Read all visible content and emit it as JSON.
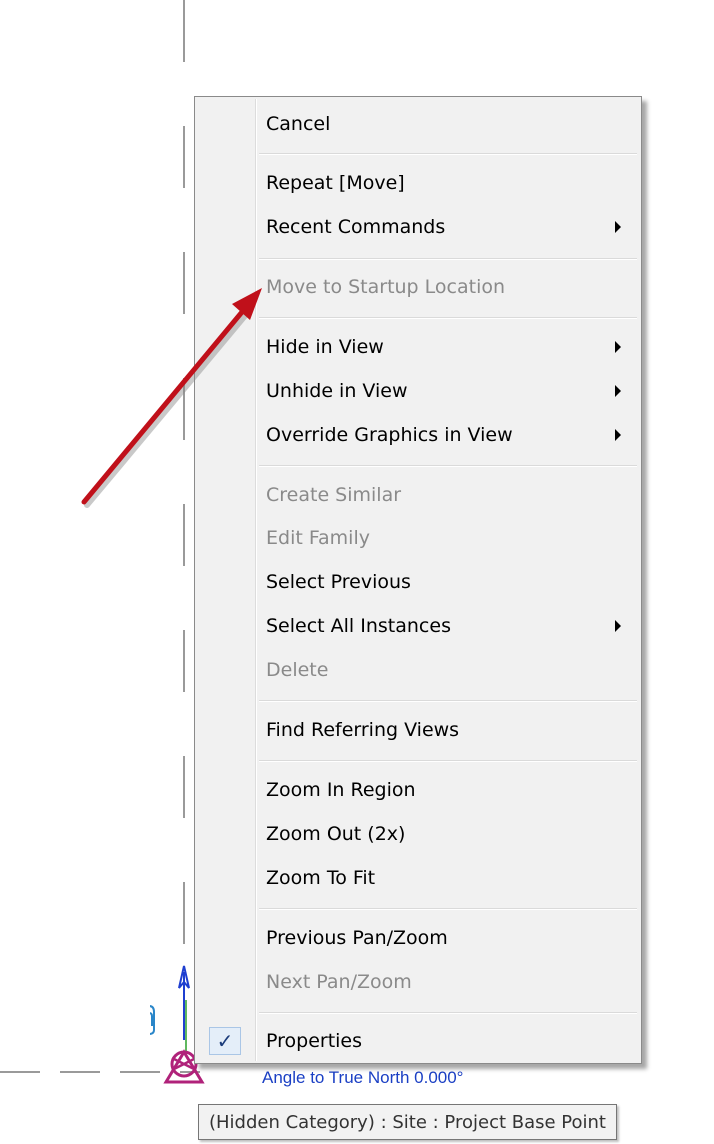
{
  "context_menu": {
    "items": [
      {
        "label": "Cancel",
        "disabled": false
      },
      {
        "label": "Repeat [Move]",
        "disabled": false
      },
      {
        "label": "Recent Commands",
        "disabled": false,
        "submenu": true
      },
      {
        "label": "Move to Startup Location",
        "disabled": true
      },
      {
        "label": "Hide in View",
        "disabled": false,
        "submenu": true
      },
      {
        "label": "Unhide in View",
        "disabled": false,
        "submenu": true
      },
      {
        "label": "Override Graphics in View",
        "disabled": false,
        "submenu": true
      },
      {
        "label": "Create Similar",
        "disabled": true
      },
      {
        "label": "Edit Family",
        "disabled": true
      },
      {
        "label": "Select Previous",
        "disabled": false
      },
      {
        "label": "Select All Instances",
        "disabled": false,
        "submenu": true
      },
      {
        "label": "Delete",
        "disabled": true
      },
      {
        "label": "Find Referring Views",
        "disabled": false
      },
      {
        "label": "Zoom In Region",
        "disabled": false
      },
      {
        "label": "Zoom Out (2x)",
        "disabled": false
      },
      {
        "label": "Zoom To Fit",
        "disabled": false
      },
      {
        "label": "Previous Pan/Zoom",
        "disabled": false
      },
      {
        "label": "Next Pan/Zoom",
        "disabled": true
      },
      {
        "label": "Properties",
        "disabled": false,
        "checked": true
      }
    ]
  },
  "canvas": {
    "angle_label": "Angle to True North   0.000°",
    "tooltip": "(Hidden Category) : Site : Project Base Point"
  },
  "icons": {
    "check": "checkmark-icon",
    "submenu": "chevron-right-icon",
    "pin": "paperclip-pin-icon",
    "site_point": "project-base-point-icon",
    "annotation_arrow": "red-arrow-annotation"
  },
  "colors": {
    "menu_bg": "#f1f1f1",
    "disabled_text": "#8a8a8a",
    "annotation_red": "#c0101a",
    "angle_text": "#1a3fc4",
    "base_point_magenta": "#b0227a"
  }
}
